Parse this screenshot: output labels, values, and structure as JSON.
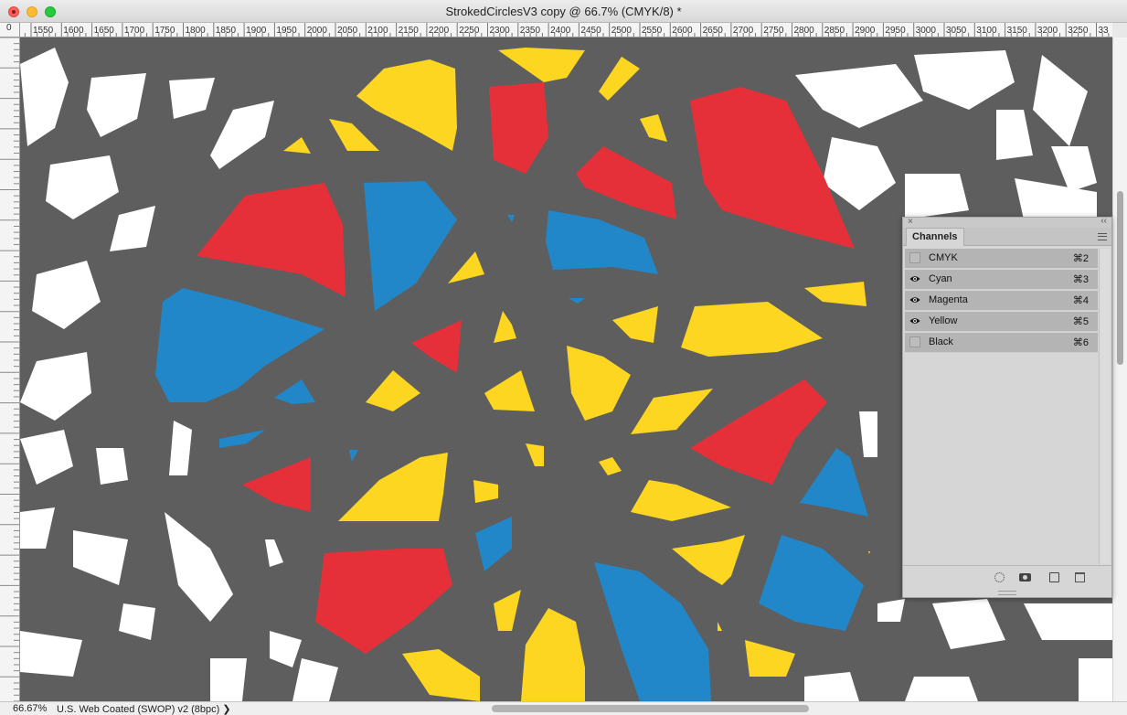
{
  "window": {
    "title": "StrokedCirclesV3 copy @ 66.7% (CMYK/8) *"
  },
  "ruler": {
    "corner_label": "0",
    "h_labels": [
      "1550",
      "1600",
      "1650",
      "1700",
      "1750",
      "1800",
      "1850",
      "1900",
      "1950",
      "2000",
      "2050",
      "2100",
      "2150",
      "2200",
      "2250",
      "2300",
      "2350",
      "2400",
      "2450",
      "2500",
      "2550",
      "2600",
      "2650",
      "2700",
      "2750",
      "2800",
      "2850",
      "2900",
      "2950",
      "3000",
      "3050",
      "3100",
      "3150",
      "3200",
      "3250",
      "33"
    ]
  },
  "canvas": {
    "colors": {
      "background": "#5e5e5e",
      "white": "#ffffff",
      "red": "#e5303a",
      "blue": "#2287c8",
      "yellow": "#fdd621"
    }
  },
  "channels_panel": {
    "tab_label": "Channels",
    "close_glyph": "×",
    "collapse_glyph": "‹‹",
    "rows": [
      {
        "name": "CMYK",
        "shortcut": "⌘2",
        "visible": false
      },
      {
        "name": "Cyan",
        "shortcut": "⌘3",
        "visible": true
      },
      {
        "name": "Magenta",
        "shortcut": "⌘4",
        "visible": true
      },
      {
        "name": "Yellow",
        "shortcut": "⌘5",
        "visible": true
      },
      {
        "name": "Black",
        "shortcut": "⌘6",
        "visible": false
      }
    ],
    "icons": [
      "load-selection-icon",
      "save-selection-icon",
      "new-channel-icon",
      "trash-icon"
    ]
  },
  "status_bar": {
    "zoom": "66.67%",
    "profile": "U.S. Web Coated (SWOP) v2 (8bpc)",
    "arrow": "❯"
  }
}
